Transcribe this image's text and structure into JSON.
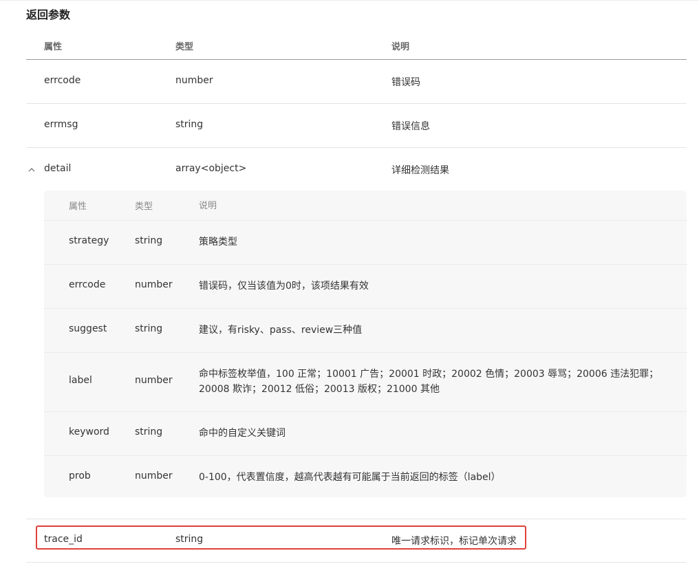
{
  "section_title": "返回参数",
  "outer_header": {
    "attr": "属性",
    "type": "类型",
    "desc": "说明"
  },
  "outer_rows": {
    "errcode": {
      "name": "errcode",
      "type": "number",
      "desc": "错误码"
    },
    "errmsg": {
      "name": "errmsg",
      "type": "string",
      "desc": "错误信息"
    },
    "detail": {
      "name": "detail",
      "type": "array<object>",
      "desc": "详细检测结果"
    },
    "trace_id": {
      "name": "trace_id",
      "type": "string",
      "desc": "唯一请求标识，标记单次请求"
    }
  },
  "detail_header": {
    "attr": "属性",
    "type": "类型",
    "desc": "说明"
  },
  "detail_rows": [
    {
      "name": "strategy",
      "type": "string",
      "desc": "策略类型"
    },
    {
      "name": "errcode",
      "type": "number",
      "desc": "错误码，仅当该值为0时，该项结果有效"
    },
    {
      "name": "suggest",
      "type": "string",
      "desc": "建议，有risky、pass、review三种值"
    },
    {
      "name": "label",
      "type": "number",
      "desc": "命中标签枚举值，100 正常；10001 广告；20001 时政；20002 色情；20003 辱骂；20006 违法犯罪；20008 欺诈；20012 低俗；20013 版权；21000 其他"
    },
    {
      "name": "keyword",
      "type": "string",
      "desc": "命中的自定义关键词"
    },
    {
      "name": "prob",
      "type": "number",
      "desc": "0-100，代表置信度，越高代表越有可能属于当前返回的标签（label）"
    }
  ],
  "icons": {
    "expand": "chevron-up-icon"
  },
  "colors": {
    "highlight_border": "#e0413a",
    "nested_background": "#f7f7f7"
  }
}
